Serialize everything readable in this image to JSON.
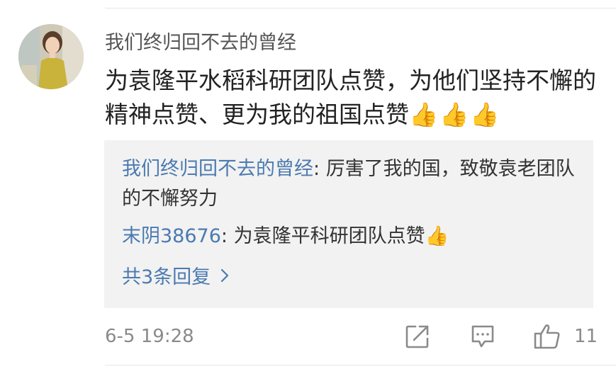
{
  "comment": {
    "username": "我们终归回不去的曾经",
    "text": "为袁隆平水稻科研团队点赞，为他们坚持不懈的精神点赞、更为我的祖国点赞",
    "emoji": "👍👍👍",
    "time": "6-5 19:28",
    "like_count": "11"
  },
  "replies": [
    {
      "name": "我们终归回不去的曾经",
      "separator": ": ",
      "text": "厉害了我的国，致敬袁老团队的不懈努力",
      "emoji": ""
    },
    {
      "name": "末阴38676",
      "separator": ": ",
      "text": "为袁隆平科研团队点赞",
      "emoji": "👍"
    }
  ],
  "more_replies": "共3条回复",
  "icons": {
    "share": "share-icon",
    "comment": "comment-icon",
    "like": "thumbs-up-icon",
    "more": "chevron-right-icon"
  },
  "colors": {
    "link": "#4b7ab0",
    "reply_bg": "#f2f2f2",
    "meta": "#8a8a8a"
  }
}
